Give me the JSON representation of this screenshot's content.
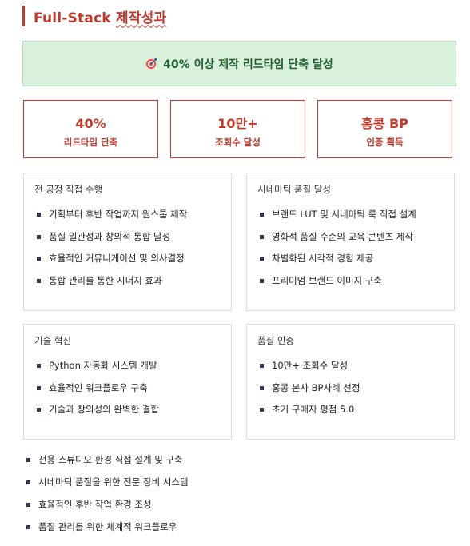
{
  "header": {
    "title_latin": "Full-Stack",
    "title_korean": "제작성과"
  },
  "banner": {
    "icon": "target-icon",
    "text": "40% 이상 제작 리드타임 단축 달성"
  },
  "stats": [
    {
      "value": "40%",
      "label": "리드타임 단축"
    },
    {
      "value": "10만+",
      "label": "조회수 달성"
    },
    {
      "value": "홍콩 BP",
      "label": "인증 획득"
    }
  ],
  "cards": [
    {
      "title": "전 공정 직접 수행",
      "items": [
        "기획부터 후반 작업까지 원스톱 제작",
        "품질 일관성과 창의적 통합 달성",
        "효율적인 커뮤니케이션 및 의사결정",
        "통합 관리를 통한 시너지 효과"
      ]
    },
    {
      "title": "시네마틱 품질 달성",
      "items": [
        "브랜드 LUT 및 시네마틱 룩 직접 설계",
        "영화적 품질 수준의 교육 콘텐츠 제작",
        "차별화된 시각적 경험 제공",
        "프리미엄 브랜드 이미지 구축"
      ]
    },
    {
      "title": "기술 혁신",
      "items": [
        "Python 자동화 시스템 개발",
        "효율적인 워크플로우 구축",
        "기술과 창의성의 완벽한 결합"
      ]
    },
    {
      "title": "품질 인증",
      "items": [
        "10만+ 조회수 달성",
        "홍콩 본사 BP사례 선정",
        "초기 구매자 평점 5.0"
      ]
    }
  ],
  "bottom_list": [
    "전용 스튜디오 환경 직접 설계 및 구축",
    "시네마틱 품질을 위한 전문 장비 시스템",
    "효율적인 후반 작업 환경 조성",
    "품질 관리를 위한 체계적 워크플로우"
  ],
  "colors": {
    "accent": "#c0392b",
    "banner_bg": "#d9f0dd",
    "banner_text": "#1e5c2c",
    "bullet": "#2b3a55"
  }
}
